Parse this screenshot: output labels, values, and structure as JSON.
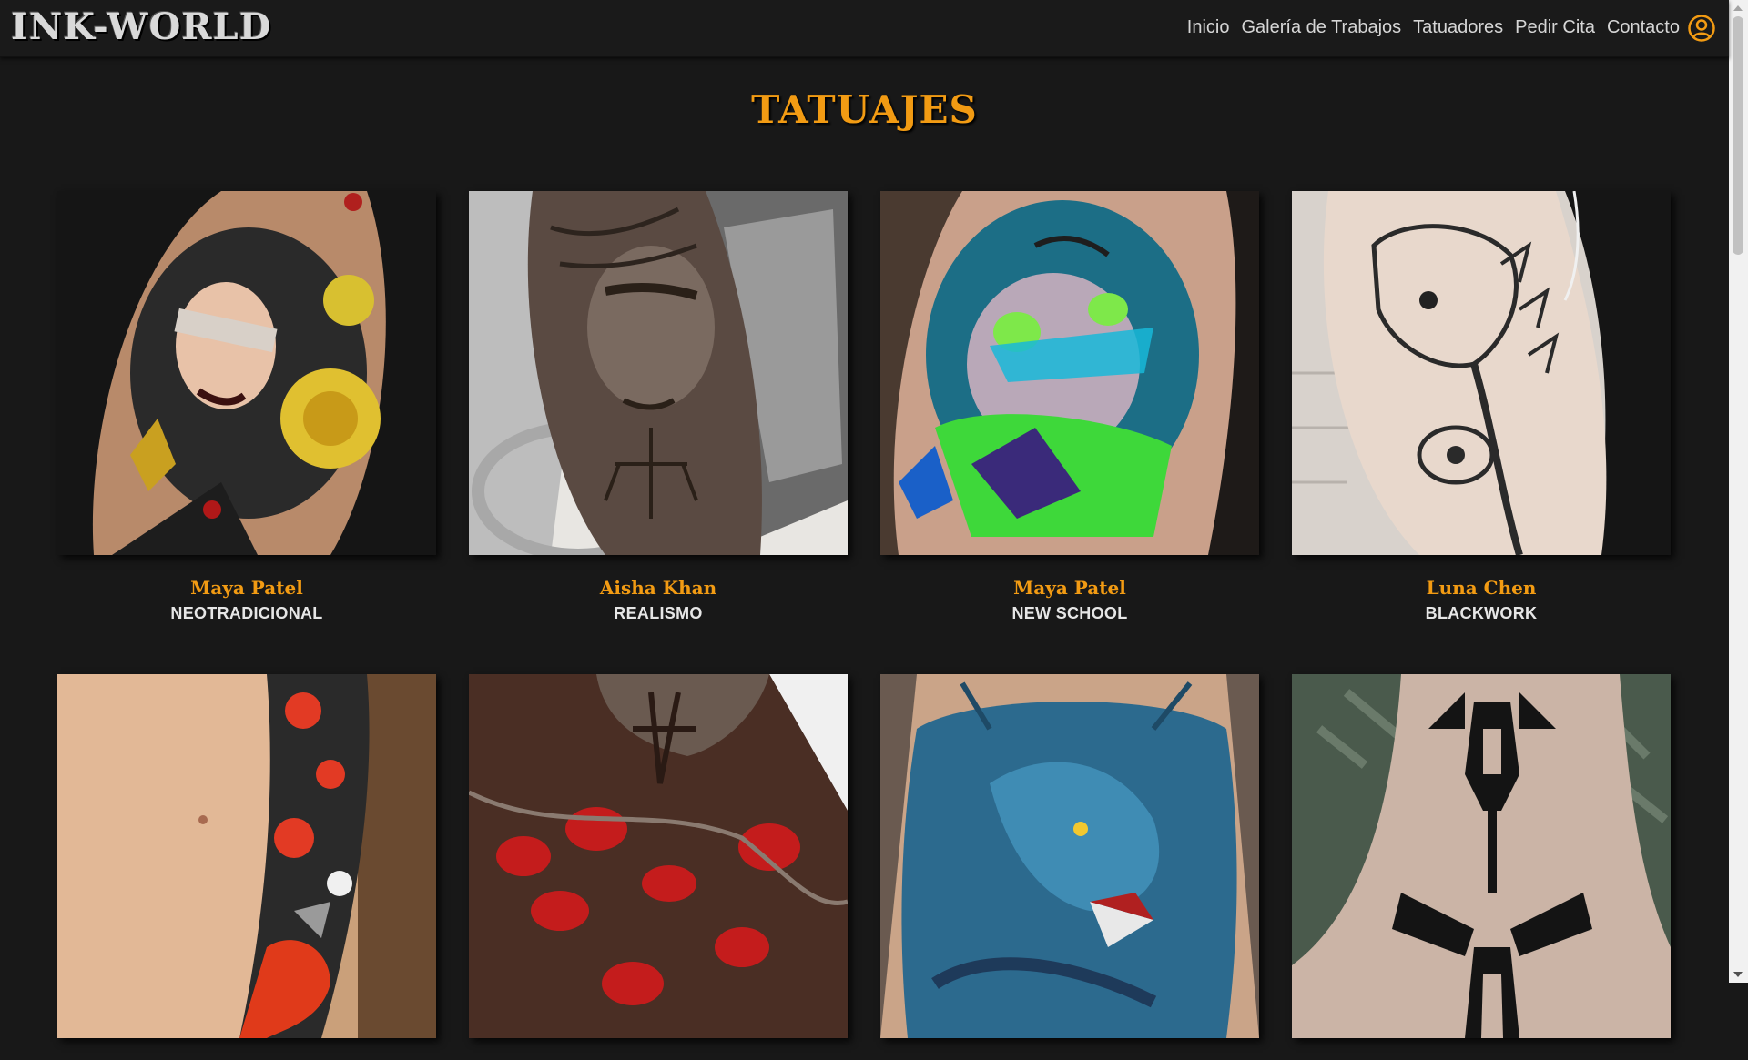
{
  "header": {
    "logo": "INK-WORLD",
    "nav": [
      "Inicio",
      "Galería de Trabajos",
      "Tatuadores",
      "Pedir Cita",
      "Contacto"
    ],
    "user_icon": "user-circle-icon"
  },
  "page": {
    "title": "TATUAJES"
  },
  "gallery": [
    {
      "artist": "Maya Patel",
      "style": "NEOTRADICIONAL"
    },
    {
      "artist": "Aisha Khan",
      "style": "REALISMO"
    },
    {
      "artist": "Maya Patel",
      "style": "NEW SCHOOL"
    },
    {
      "artist": "Luna Chen",
      "style": "BLACKWORK"
    },
    {
      "artist": "",
      "style": ""
    },
    {
      "artist": "",
      "style": ""
    },
    {
      "artist": "",
      "style": ""
    },
    {
      "artist": "",
      "style": ""
    }
  ],
  "colors": {
    "accent": "#f29b13",
    "background": "#181818",
    "header": "#1a1a1a"
  }
}
